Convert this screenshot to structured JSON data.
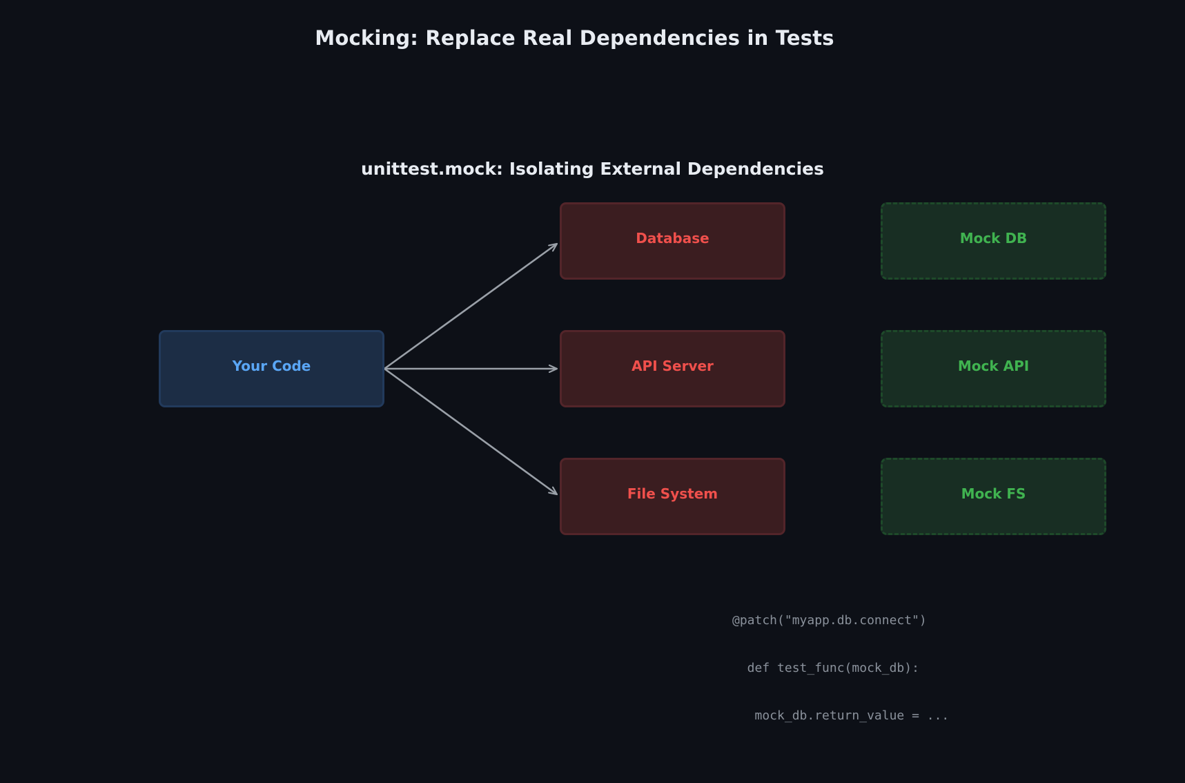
{
  "title": "Mocking: Replace Real Dependencies in Tests",
  "subtitle": "unittest.mock: Isolating External Dependencies",
  "source_box": {
    "label": "Your Code"
  },
  "real_dependencies": [
    {
      "label": "Database"
    },
    {
      "label": "API Server"
    },
    {
      "label": "File System"
    }
  ],
  "mock_dependencies": [
    {
      "label": "Mock DB"
    },
    {
      "label": "Mock API"
    },
    {
      "label": "Mock FS"
    }
  ],
  "code_snippet": [
    "@patch(\"myapp.db.connect\")",
    "  def test_func(mock_db):",
    "   mock_db.return_value = ..."
  ],
  "colors": {
    "background": "#0d1017",
    "source": "#5aa6f5",
    "real": "#f0504c",
    "mock": "#40b350",
    "arrow": "#9aa0a8"
  }
}
